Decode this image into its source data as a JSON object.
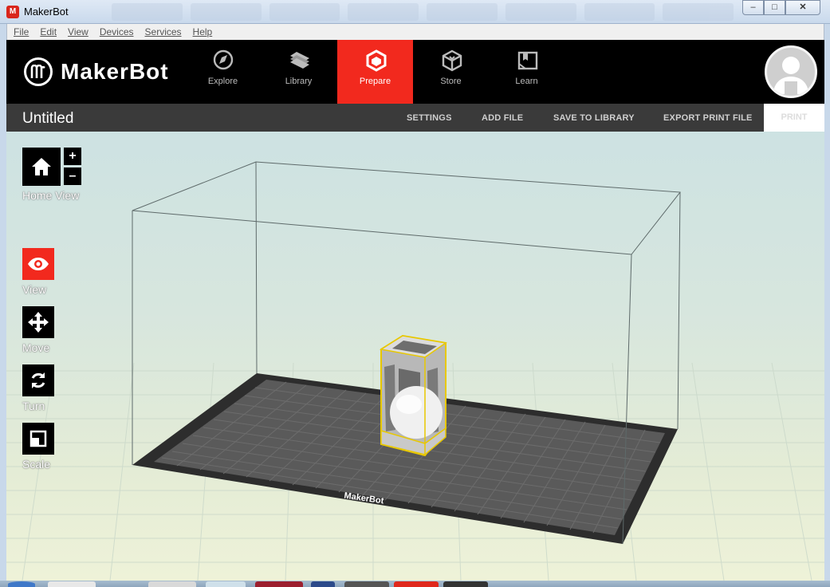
{
  "window": {
    "title": "MakerBot",
    "minimize": "–",
    "maximize": "□",
    "close": "✕"
  },
  "menu": [
    "File",
    "Edit",
    "View",
    "Devices",
    "Services",
    "Help"
  ],
  "brand": {
    "name": "MakerBot",
    "accent": "#f2291e"
  },
  "nav": [
    {
      "label": "Explore",
      "icon": "compass-icon"
    },
    {
      "label": "Library",
      "icon": "library-icon"
    },
    {
      "label": "Prepare",
      "icon": "prepare-icon",
      "active": true
    },
    {
      "label": "Store",
      "icon": "store-icon"
    },
    {
      "label": "Learn",
      "icon": "learn-icon"
    }
  ],
  "document": {
    "title": "Untitled"
  },
  "actions": {
    "settings": "SETTINGS",
    "add_file": "ADD FILE",
    "save": "SAVE TO LIBRARY",
    "export": "EXPORT PRINT FILE",
    "print": "PRINT"
  },
  "tools": {
    "home": "Home View",
    "zoom_in": "+",
    "zoom_out": "–",
    "view": "View",
    "move": "Move",
    "turn": "Turn",
    "scale": "Scale"
  },
  "plate_label": "MakerBot"
}
